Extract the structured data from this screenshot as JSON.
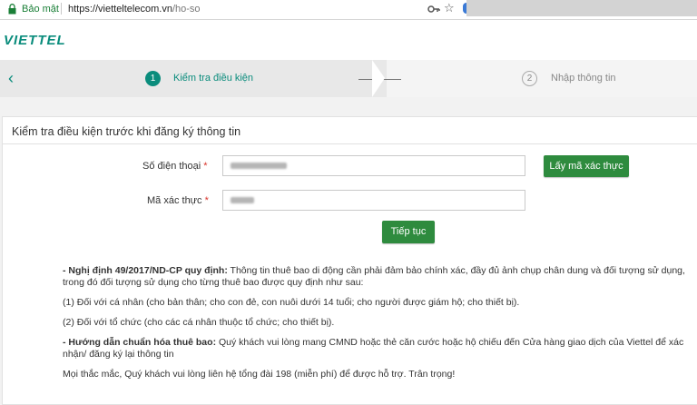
{
  "browser": {
    "secure_label": "Bảo mật",
    "url_host": "https://vietteltelecom.vn",
    "url_path": "/ho-so"
  },
  "header": {
    "logo_text": "VIETTEL"
  },
  "stepper": {
    "steps": [
      {
        "number": "1",
        "label": "Kiểm tra điều kiện",
        "active": true
      },
      {
        "number": "2",
        "label": "Nhập thông tin",
        "active": false
      }
    ]
  },
  "form": {
    "title": "Kiểm tra điều kiện trước khi đăng ký thông tin",
    "phone_label": "Số điện thoại",
    "code_label": "Mã xác thực",
    "required_mark": "*",
    "get_code_button": "Lấy mã xác thực",
    "continue_button": "Tiếp tục"
  },
  "notes": {
    "decree_title": "- Nghị định 49/2017/ND-CP quy định:",
    "decree_text": " Thông tin thuê bao di động cần phải đảm bảo chính xác, đầy đủ ảnh chụp chân dung và đối tượng sử dụng, trong đó đối tượng sử dụng cho từng thuê bao được quy định như sau:",
    "item1": "(1) Đối với cá nhân (cho bản thân; cho con đẻ, con nuôi dưới 14 tuổi; cho người được giám hộ; cho thiết bị).",
    "item2": "(2) Đối với tổ chức (cho các cá nhân thuộc tổ chức; cho thiết bị).",
    "guide_title": "- Hướng dẫn chuẩn hóa thuê bao:",
    "guide_text": " Quý khách vui lòng mang CMND hoặc thẻ căn cước hoặc hộ chiếu đến Cửa hàng giao dịch của Viettel để xác nhận/ đăng ký lại thông tin",
    "support": "Mọi thắc mắc, Quý khách vui lòng liên hệ tổng đài 198 (miễn phí) để được hỗ trợ. Trân trọng!"
  },
  "colors": {
    "brand": "#0a8c7c",
    "button": "#2e8b3e",
    "required": "#d9342b"
  }
}
